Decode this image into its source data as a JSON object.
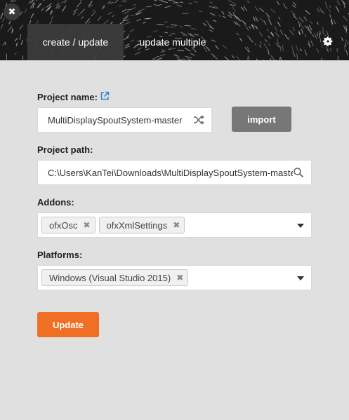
{
  "header": {
    "close_icon": "close-icon",
    "tabs": [
      {
        "label": "create / update",
        "active": true
      },
      {
        "label": "update multiple",
        "active": false
      }
    ],
    "settings_icon": "gear-icon"
  },
  "form": {
    "project_name": {
      "label": "Project name:",
      "value": "MultiDisplaySpoutSystem-master",
      "link_icon": "external-link-icon",
      "random_icon": "shuffle-icon"
    },
    "import_label": "import",
    "project_path": {
      "label": "Project path:",
      "value": "C:\\Users\\KanTei\\Downloads\\MultiDisplaySpoutSystem-master",
      "search_icon": "search-icon"
    },
    "addons": {
      "label": "Addons:",
      "items": [
        "ofxOsc",
        "ofxXmlSettings"
      ]
    },
    "platforms": {
      "label": "Platforms:",
      "items": [
        "Windows (Visual Studio 2015)"
      ]
    },
    "update_label": "Update"
  },
  "colors": {
    "accent": "#ef6f25",
    "import_button": "#777777",
    "link": "#3a86c8",
    "header_bg": "#1a1a1a"
  }
}
